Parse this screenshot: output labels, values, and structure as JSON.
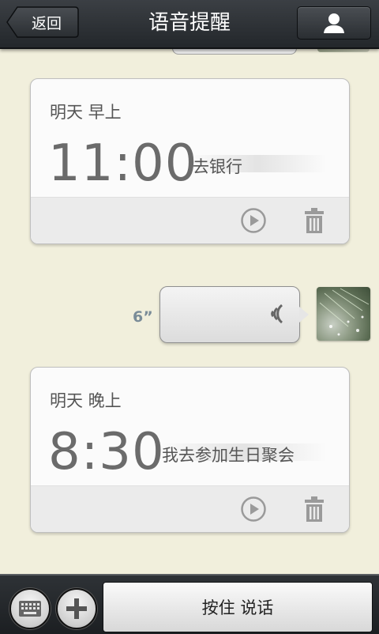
{
  "header": {
    "back_label": "返回",
    "title": "语音提醒",
    "profile_icon": "person-icon"
  },
  "reminders": [
    {
      "day": "明天 早上",
      "time": "11:00",
      "note": "去银行"
    },
    {
      "day": "明天 晚上",
      "time": "8:30",
      "note": "我去参加生日聚会"
    }
  ],
  "voice_message": {
    "duration": "6”"
  },
  "bottom": {
    "keyboard_icon": "keyboard-icon",
    "plus_icon": "plus-icon",
    "talk_label": "按住 说话"
  },
  "colors": {
    "background": "#f1efdc",
    "topbar": "#2b2f33",
    "card": "#fbfbfb",
    "duration_text": "#7a8c98"
  }
}
